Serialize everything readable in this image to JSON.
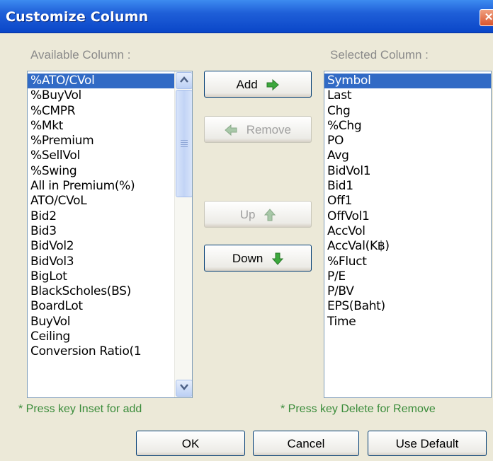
{
  "window": {
    "title": "Customize Column",
    "close_glyph": "✕"
  },
  "available": {
    "label": "Available Column :",
    "items": [
      "%ATO/CVol",
      "%BuyVol",
      "%CMPR",
      "%Mkt",
      "%Premium",
      "%SellVol",
      "%Swing",
      "All in Premium(%)",
      "ATO/CVoL",
      "Bid2",
      "Bid3",
      "BidVol2",
      "BidVol3",
      "BigLot",
      "BlackScholes(BS)",
      "BoardLot",
      "BuyVol",
      "Ceiling",
      "Conversion Ratio(1"
    ],
    "selected_index": 0
  },
  "selected": {
    "label": "Selected Column :",
    "items": [
      "Symbol",
      "Last",
      "Chg",
      "%Chg",
      "PO",
      "Avg",
      "BidVol1",
      "Bid1",
      "Off1",
      "OffVol1",
      "AccVol",
      "AccVal(K฿)",
      "%Fluct",
      "P/E",
      "P/BV",
      "EPS(Baht)",
      "Time"
    ],
    "selected_index": 0
  },
  "buttons": {
    "add": "Add",
    "remove": "Remove",
    "up": "Up",
    "down": "Down",
    "ok": "OK",
    "cancel": "Cancel",
    "use_default": "Use Default"
  },
  "hints": {
    "add": "* Press key Inset for add",
    "remove": "* Press key Delete for Remove"
  },
  "icons": {
    "add": "green-right-arrow-icon",
    "remove": "green-left-arrow-icon",
    "up": "green-up-arrow-icon",
    "down": "green-down-arrow-icon"
  },
  "colors": {
    "arrow_green": "#3CA83C",
    "selection": "#316AC5",
    "titlebar": "#0A46C8"
  }
}
